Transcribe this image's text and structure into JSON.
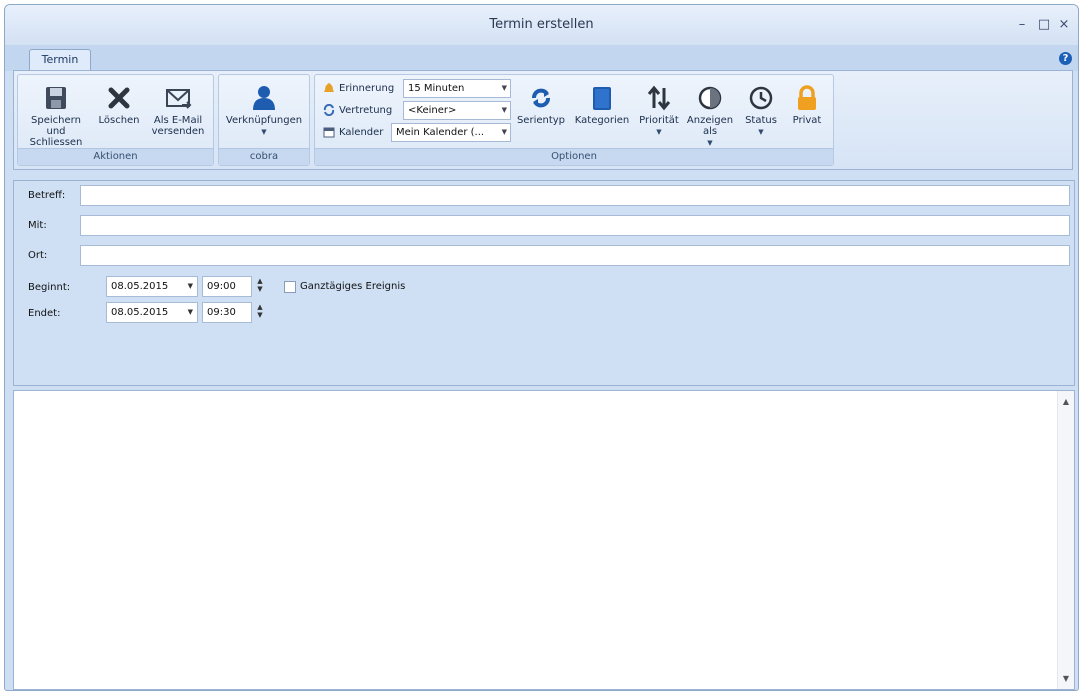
{
  "window": {
    "title": "Termin erstellen",
    "minimize": "–",
    "maximize": "□",
    "close": "×"
  },
  "tabs": [
    {
      "label": "Termin"
    }
  ],
  "help": "?",
  "ribbon": {
    "groups": {
      "aktionen": {
        "label": "Aktionen",
        "save": [
          "Speichern und",
          "Schliessen"
        ],
        "delete": "Löschen",
        "email": [
          "Als E-Mail",
          "versenden"
        ]
      },
      "cobra": {
        "label": "cobra",
        "links": "Verknüpfungen"
      },
      "optionen": {
        "label": "Optionen",
        "erinnerung": {
          "label": "Erinnerung",
          "value": "15 Minuten"
        },
        "vertretung": {
          "label": "Vertretung",
          "value": "<Keiner>"
        },
        "kalender": {
          "label": "Kalender",
          "value": "Mein Kalender (..."
        },
        "serientyp": "Serientyp",
        "kategorien": "Kategorien",
        "prioritaet": "Priorität",
        "anzeigen": [
          "Anzeigen",
          "als"
        ],
        "status": "Status",
        "privat": "Privat"
      }
    }
  },
  "form": {
    "betreff": {
      "label": "Betreff:",
      "value": ""
    },
    "mit": {
      "label": "Mit:",
      "value": ""
    },
    "ort": {
      "label": "Ort:",
      "value": ""
    },
    "beginnt": {
      "label": "Beginnt:",
      "date": "08.05.2015",
      "time": "09:00"
    },
    "endet": {
      "label": "Endet:",
      "date": "08.05.2015",
      "time": "09:30"
    },
    "ganztaegig": {
      "label": "Ganztägiges Ereignis",
      "checked": false
    }
  },
  "colors": {
    "accent": "#1c5fb8",
    "ribbon": "#d6e4f6",
    "panel": "#cfe0f5",
    "lock": "#f0a020"
  }
}
